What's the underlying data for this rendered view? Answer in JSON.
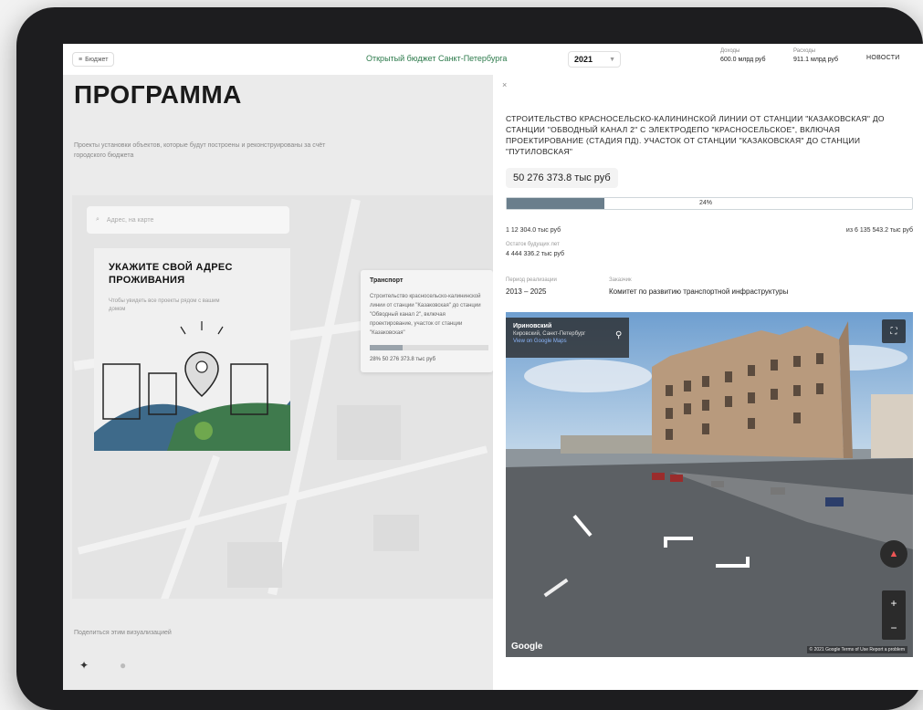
{
  "header": {
    "back_label": "Бюджет",
    "site_title": "Открытый бюджет Санкт-Петербурга",
    "year": "2021",
    "stat1_label": "Доходы",
    "stat1_value": "600.0 млрд руб",
    "stat2_label": "Расходы",
    "stat2_value": "911.1 млрд руб",
    "news_label": "НОВОСТИ"
  },
  "left": {
    "title": "ПРОГРАММА",
    "description": "Проекты установки объектов, которые будут построены и реконструированы за счёт городского бюджета",
    "search_placeholder": "Адрес, на карте",
    "address_card_title": "УКАЖИТЕ СВОЙ АДРЕС ПРОЖИВАНИЯ",
    "address_card_text": "Чтобы увидеть все проекты рядом с вашим домом",
    "popup_title": "Транспорт",
    "popup_text": "Строительство красносельско-калининской линии от станции \"Казаковская\" до станции \"Обводный канал 2\", включая проектирование, участок от станции \"Казаковская\"",
    "popup_amount": "28% 50 276 373.8 тыс руб",
    "share_label": "Поделиться этим визуализацией"
  },
  "detail": {
    "close": "×",
    "project_title": "СТРОИТЕЛЬСТВО КРАСНОСЕЛЬСКО-КАЛИНИНСКОЙ ЛИНИИ ОТ СТАНЦИИ \"КАЗАКОВСКАЯ\" ДО СТАНЦИИ \"ОБВОДНЫЙ КАНАЛ 2\" С ЭЛЕКТРОДЕПО \"КРАСНОСЕЛЬСКОЕ\", ВКЛЮЧАЯ ПРОЕКТИРОВАНИЕ (СТАДИЯ ПД). УЧАСТОК ОТ СТАНЦИИ \"КАЗАКОВСКАЯ\" ДО СТАНЦИИ \"ПУТИЛОВСКАЯ\"",
    "amount": "50 276 373.8 тыс руб",
    "progress_pct": 0.24,
    "progress_label": "24%",
    "spent": "1 12 304.0 тыс руб",
    "total": "из 6 135 543.2 тыс руб",
    "remaining_label": "Остаток будущих лет",
    "remaining_value": "4 444 336.2 тыс руб",
    "period_label": "Период реализации",
    "period_value": "2013 – 2025",
    "customer_label": "Заказчик",
    "customer_value": "Комитет по развитию транспортной инфраструктуры"
  },
  "streetview": {
    "place": "Ириновский",
    "address": "Кировский, Санкт-Петербург",
    "link": "View on Google Maps",
    "brand": "Google",
    "terms": "© 2021 Google  Terms of Use  Report a problem"
  },
  "icons": {
    "search": "search-icon",
    "pin": "map-pin-icon",
    "fullscreen": "fullscreen-icon",
    "compass": "compass-icon"
  },
  "colors": {
    "accent_green": "#2c7a4b",
    "progress_fill": "#6a7e8c"
  }
}
